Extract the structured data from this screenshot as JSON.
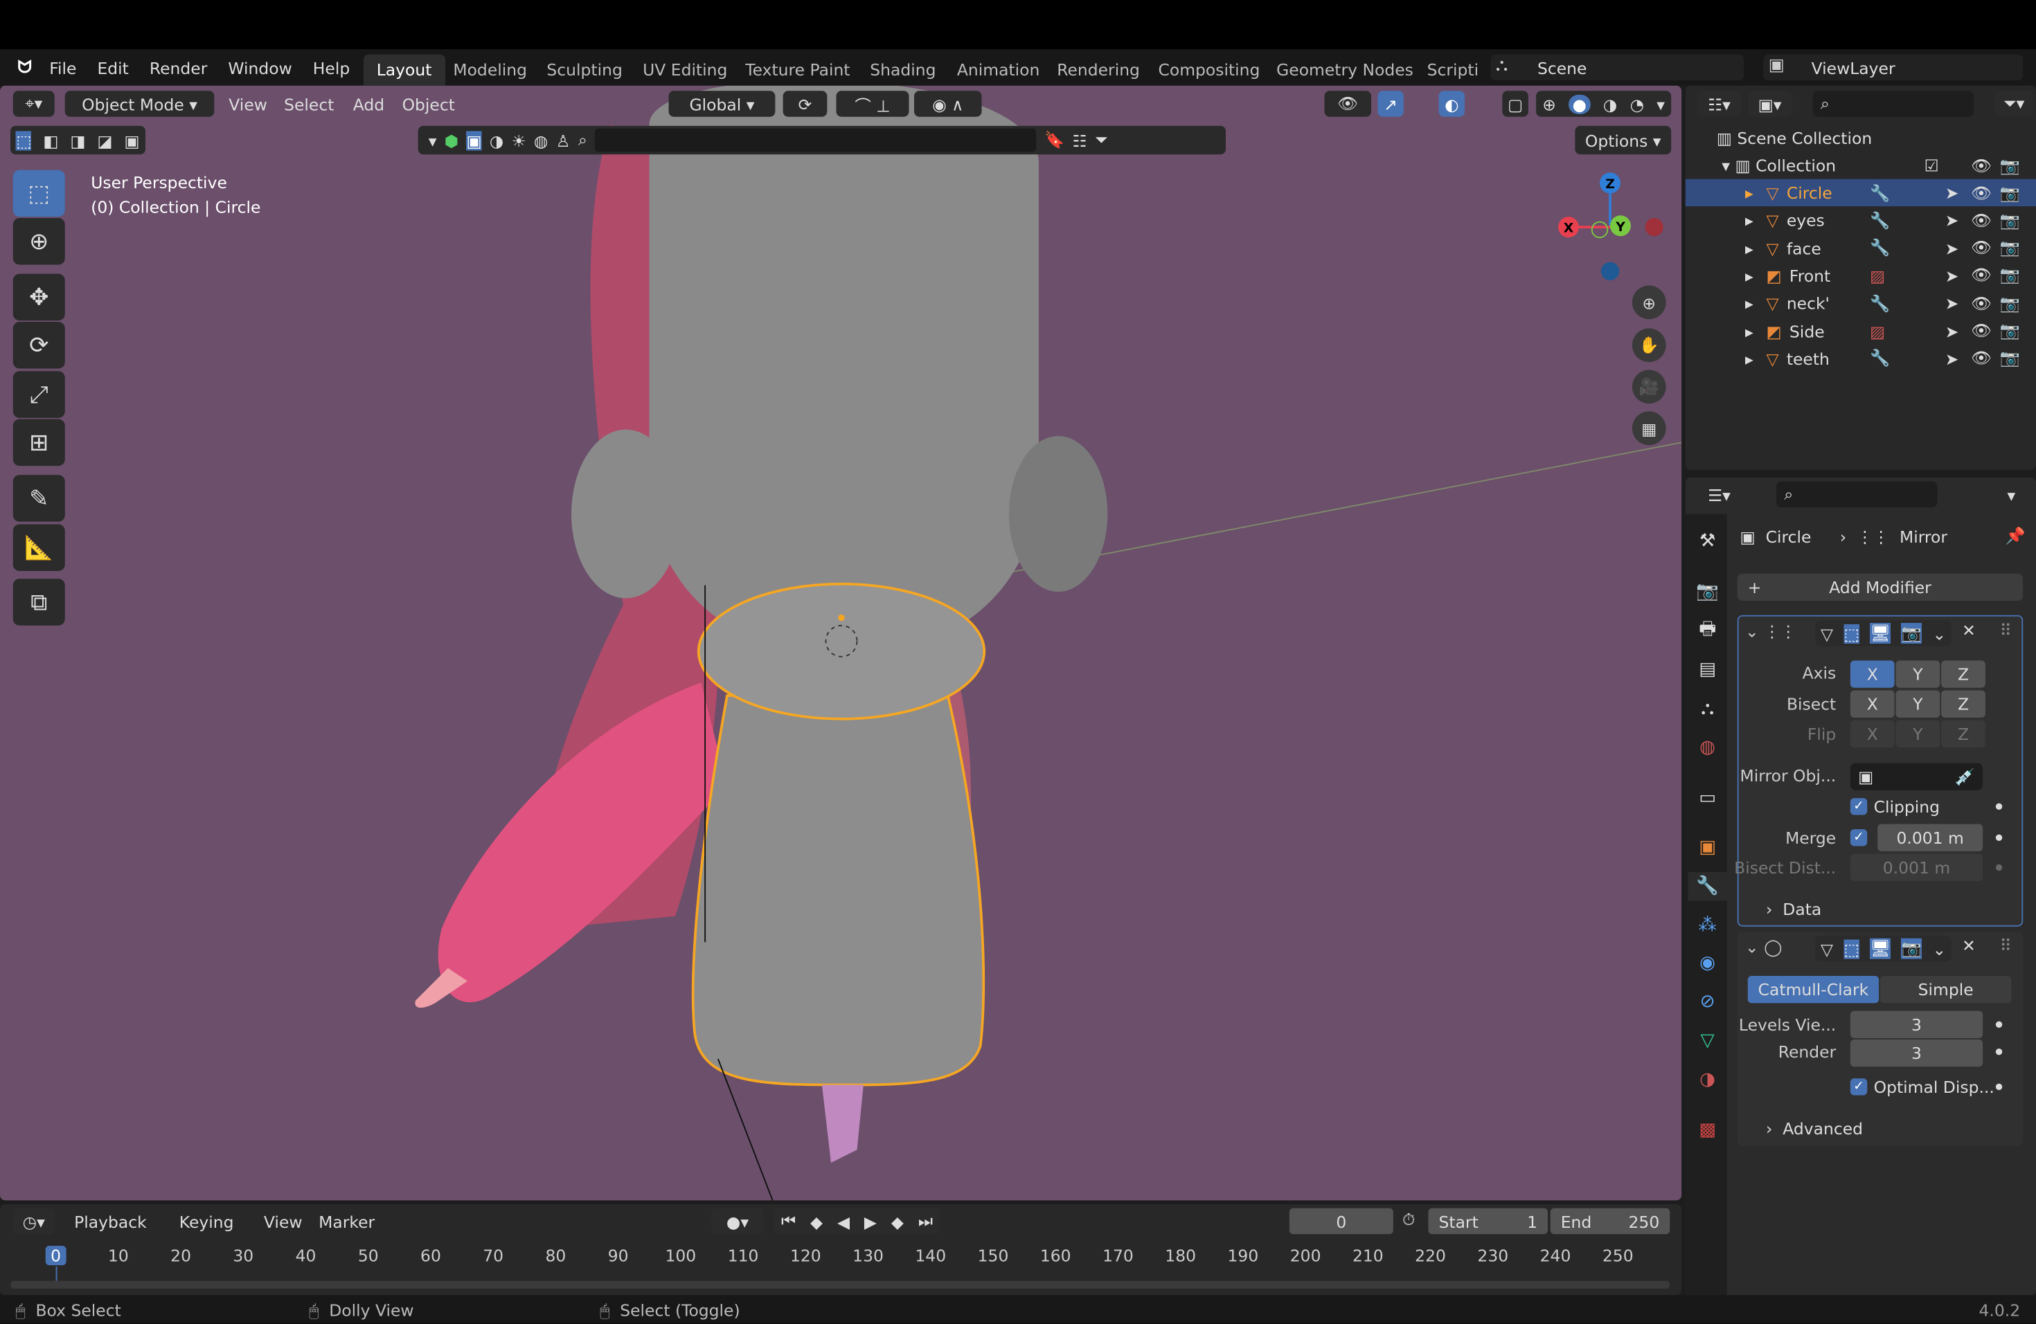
{
  "menu": {
    "items": [
      "File",
      "Edit",
      "Render",
      "Window",
      "Help"
    ]
  },
  "workspaces": [
    "Layout",
    "Modeling",
    "Sculpting",
    "UV Editing",
    "Texture Paint",
    "Shading",
    "Animation",
    "Rendering",
    "Compositing",
    "Geometry Nodes",
    "Scripti"
  ],
  "active_workspace": "Layout",
  "scene": {
    "name": "Scene",
    "view_layer": "ViewLayer"
  },
  "viewport": {
    "mode": "Object Mode",
    "menus": [
      "View",
      "Select",
      "Add",
      "Object"
    ],
    "transform_orientation": "Global",
    "options_label": "Options",
    "overlay_title": "User Perspective",
    "overlay_subtitle": "(0) Collection | Circle",
    "gizmo_axes": [
      "X",
      "Y",
      "Z"
    ],
    "colors": {
      "background": "#6b4f6b",
      "selection_outline": "#f5a623"
    }
  },
  "outliner": {
    "root": "Scene Collection",
    "collection": "Collection",
    "items": [
      {
        "name": "Circle",
        "selected": true,
        "type": "mesh"
      },
      {
        "name": "eyes",
        "type": "mesh"
      },
      {
        "name": "face",
        "type": "mesh"
      },
      {
        "name": "Front",
        "type": "image"
      },
      {
        "name": "neck'",
        "type": "mesh"
      },
      {
        "name": "Side",
        "type": "image"
      },
      {
        "name": "teeth",
        "type": "mesh"
      }
    ]
  },
  "properties": {
    "breadcrumb": {
      "object": "Circle",
      "modifier": "Mirror"
    },
    "add_modifier": "Add Modifier",
    "mirror": {
      "axis_label": "Axis",
      "bisect_label": "Bisect",
      "flip_label": "Flip",
      "axes": [
        "X",
        "Y",
        "Z"
      ],
      "axis_active": "X",
      "mirror_object_label": "Mirror Obj...",
      "clipping_label": "Clipping",
      "clipping": true,
      "merge_label": "Merge",
      "merge": true,
      "merge_value": "0.001 m",
      "bisect_dist_label": "Bisect Dist...",
      "bisect_dist_value": "0.001 m",
      "data_label": "Data"
    },
    "subsurf": {
      "mode_options": [
        "Catmull-Clark",
        "Simple"
      ],
      "mode_active": "Catmull-Clark",
      "levels_label": "Levels Vie...",
      "levels_value": "3",
      "render_label": "Render",
      "render_value": "3",
      "optimal_label": "Optimal Disp...",
      "optimal": true,
      "advanced_label": "Advanced"
    }
  },
  "timeline": {
    "menus": [
      "Playback",
      "Keying",
      "View",
      "Marker"
    ],
    "current_frame": "0",
    "start_label": "Start",
    "start": "1",
    "end_label": "End",
    "end": "250",
    "ticks": [
      "0",
      "10",
      "20",
      "30",
      "40",
      "50",
      "60",
      "70",
      "80",
      "90",
      "100",
      "110",
      "120",
      "130",
      "140",
      "150",
      "160",
      "170",
      "180",
      "190",
      "200",
      "210",
      "220",
      "230",
      "240",
      "250"
    ]
  },
  "status": {
    "hints": [
      "Box Select",
      "Dolly View",
      "Select (Toggle)"
    ],
    "version": "4.0.2"
  }
}
